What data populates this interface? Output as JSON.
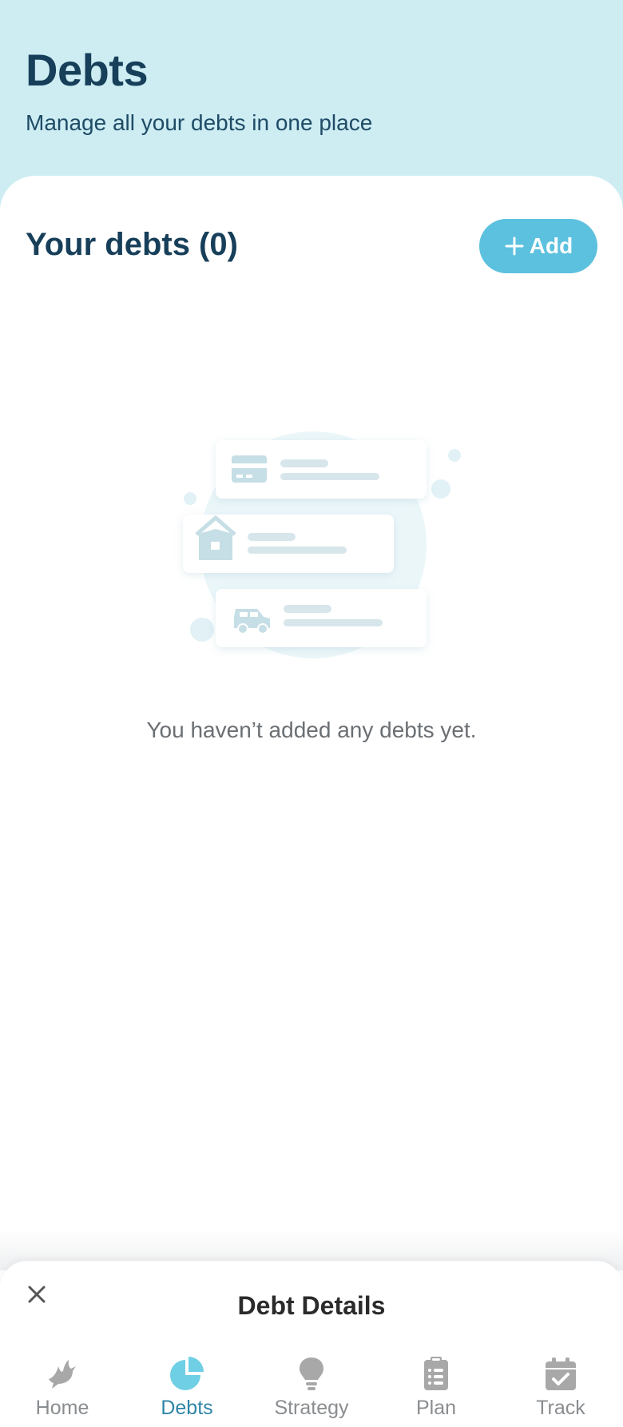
{
  "header": {
    "title": "Debts",
    "subtitle": "Manage all your debts in one place"
  },
  "debts": {
    "section_title": "Your debts (0)",
    "add_label": "Add",
    "empty_message": "You haven’t added any debts yet."
  },
  "sheet": {
    "title": "Debt Details",
    "close_icon": "close-icon"
  },
  "nav": {
    "items": [
      {
        "label": "Home",
        "icon": "dove-icon",
        "active": false
      },
      {
        "label": "Debts",
        "icon": "pie-chart-icon",
        "active": true
      },
      {
        "label": "Strategy",
        "icon": "lightbulb-icon",
        "active": false
      },
      {
        "label": "Plan",
        "icon": "clipboard-list-icon",
        "active": false
      },
      {
        "label": "Track",
        "icon": "calendar-check-icon",
        "active": false
      }
    ]
  },
  "colors": {
    "header_bg": "#cdedf3",
    "accent": "#5cc1de",
    "title_text": "#173f5a",
    "active_nav": "#2e86a8",
    "inactive_nav": "#8a8d90"
  }
}
